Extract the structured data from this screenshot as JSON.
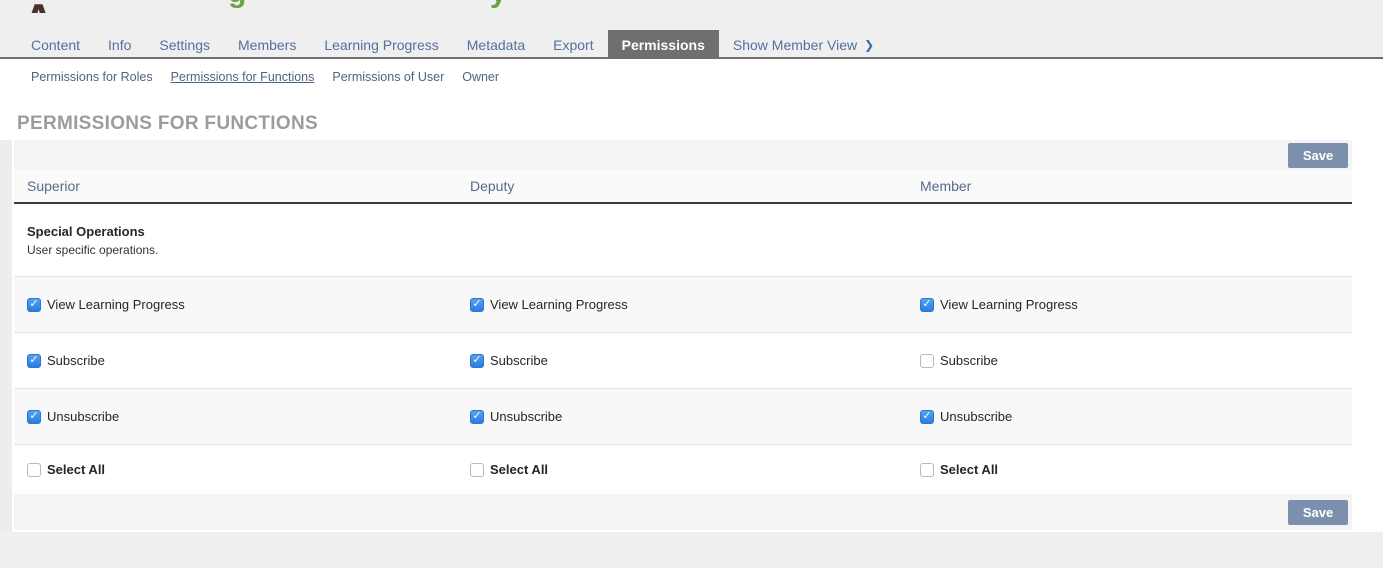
{
  "icons": {
    "chevron-right": "❯",
    "check": "✓"
  },
  "colors": {
    "accent_checkbox_blue": "#3c8ce8",
    "save_button_blue": "#7b90ad",
    "active_tab_bg": "#6f6f6f",
    "tab_text_blue": "#52719e",
    "page_title_gray": "#9c9c9c",
    "logo_brown": "#4a332a",
    "clipped_title_green": "#6ba04a"
  },
  "header": {
    "logo_fragment": "A",
    "clipped_title_fragment_1": "g",
    "clipped_title_fragment_2": "y"
  },
  "tabs": [
    {
      "label": "Content",
      "active": false
    },
    {
      "label": "Info",
      "active": false
    },
    {
      "label": "Settings",
      "active": false
    },
    {
      "label": "Members",
      "active": false
    },
    {
      "label": "Learning Progress",
      "active": false
    },
    {
      "label": "Metadata",
      "active": false
    },
    {
      "label": "Export",
      "active": false
    },
    {
      "label": "Permissions",
      "active": true
    },
    {
      "label": "Show Member View",
      "active": false,
      "trailing_icon": "chevron-right"
    }
  ],
  "subtabs": [
    {
      "label": "Permissions for Roles",
      "active": false
    },
    {
      "label": "Permissions for Functions",
      "active": true
    },
    {
      "label": "Permissions of User",
      "active": false
    },
    {
      "label": "Owner",
      "active": false
    }
  ],
  "page_title": "PERMISSIONS FOR FUNCTIONS",
  "permissions_table": {
    "save_button_label": "Save",
    "columns": [
      "Superior",
      "Deputy",
      "Member"
    ],
    "section": {
      "title": "Special Operations",
      "description": "User specific operations."
    },
    "rows": [
      {
        "label": "View Learning Progress",
        "bold": false,
        "checked": [
          true,
          true,
          true
        ]
      },
      {
        "label": "Subscribe",
        "bold": false,
        "checked": [
          true,
          true,
          false
        ]
      },
      {
        "label": "Unsubscribe",
        "bold": false,
        "checked": [
          true,
          true,
          true
        ]
      },
      {
        "label": "Select All",
        "bold": true,
        "checked": [
          false,
          false,
          false
        ]
      }
    ]
  }
}
